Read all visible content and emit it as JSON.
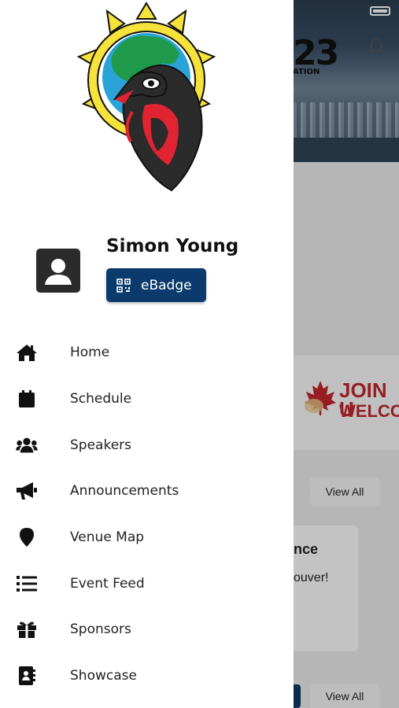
{
  "status_bar": {
    "battery_icon": "battery-full-icon"
  },
  "background": {
    "logo_text": "23",
    "logo_sub": "ATION",
    "bell_icon": "bell-icon",
    "banner": {
      "line1": "JOIN U",
      "line2": "WELCOM"
    },
    "view_all_1": "View All",
    "card": {
      "title": "nce",
      "text": "ouver!"
    },
    "view_all_2": "View All"
  },
  "drawer": {
    "user": {
      "name": "Simon Young",
      "avatar_icon": "user-avatar-icon"
    },
    "ebadge": {
      "label": "eBadge",
      "icon": "qr-code-icon"
    },
    "menu": [
      {
        "label": "Home",
        "icon": "home-icon"
      },
      {
        "label": "Schedule",
        "icon": "calendar-icon"
      },
      {
        "label": "Speakers",
        "icon": "users-icon"
      },
      {
        "label": "Announcements",
        "icon": "megaphone-icon"
      },
      {
        "label": "Venue Map",
        "icon": "map-pin-icon"
      },
      {
        "label": "Event Feed",
        "icon": "list-icon"
      },
      {
        "label": "Sponsors",
        "icon": "gift-icon"
      },
      {
        "label": "Showcase",
        "icon": "address-book-icon"
      }
    ]
  },
  "colors": {
    "accent": "#0b3b6c",
    "banner_red": "#c0272d",
    "overlay": "rgba(0,0,0,0.22)"
  }
}
